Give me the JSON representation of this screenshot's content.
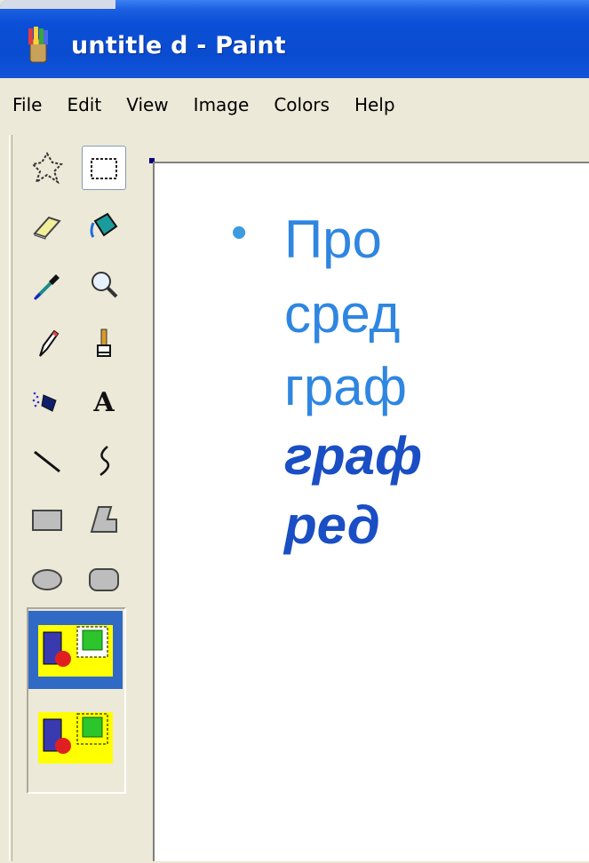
{
  "window": {
    "title": "untitle d - Paint"
  },
  "menu": [
    "File",
    "Edit",
    "View",
    "Image",
    "Colors",
    "Help"
  ],
  "toolbox": {
    "tools": [
      {
        "name": "free-form-select-icon"
      },
      {
        "name": "rect-select-icon",
        "selected": true
      },
      {
        "name": "eraser-icon"
      },
      {
        "name": "fill-bucket-icon"
      },
      {
        "name": "color-picker-icon"
      },
      {
        "name": "magnifier-icon"
      },
      {
        "name": "pencil-icon"
      },
      {
        "name": "brush-icon"
      },
      {
        "name": "airbrush-icon"
      },
      {
        "name": "text-icon",
        "glyph": "A"
      },
      {
        "name": "line-icon"
      },
      {
        "name": "curve-icon"
      },
      {
        "name": "rectangle-icon"
      },
      {
        "name": "polygon-icon"
      },
      {
        "name": "ellipse-icon"
      },
      {
        "name": "rounded-rectangle-icon"
      }
    ],
    "options": [
      {
        "name": "opaque-selection-icon",
        "selected": true
      },
      {
        "name": "transparent-selection-icon",
        "selected": false
      }
    ]
  },
  "canvas": {
    "lines": [
      "Про",
      "сред",
      "граф",
      "граф",
      "ред"
    ]
  },
  "colors": {
    "titlebar": "#0a4fd6",
    "text_blue": "#2f86e0",
    "text_dark_blue": "#1a4ec4",
    "selection": "#316ac5"
  }
}
